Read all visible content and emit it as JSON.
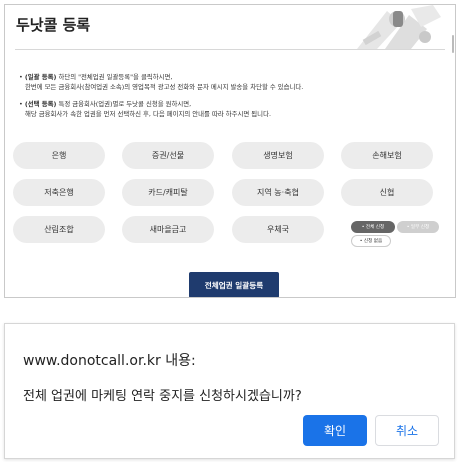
{
  "page": {
    "title": "두낫콜 등록",
    "notices": [
      {
        "lead": "(일괄 등록)",
        "line1": " 하단의 \"전체업권 일괄등록\"을 클릭하시면,",
        "line2": "한번에 모든 금융회사(참여업권 소속)의 영업목적 광고성 전화와 문자 메시지 발송을 차단할 수 있습니다."
      },
      {
        "lead": "(선택 등록)",
        "line1": " 특정 금융회사(업권)별로 두낫콜 신청을 원하시면,",
        "line2": "해당 금융회사가 속한 업권을 먼저 선택하신 후, 다음 페이지의 안내를 따라 하주시면 됩니다."
      }
    ],
    "sectors": [
      "은행",
      "증권/선물",
      "생명보험",
      "손해보험",
      "저축은행",
      "카드/캐피탈",
      "지역 농·축협",
      "신협",
      "산림조합",
      "새마을금고",
      "우체국"
    ],
    "legend": {
      "all_selected": "• 전체 신청",
      "partial_selected": "• 일부 신청",
      "unselected": "• 신청 없음"
    },
    "bulk_button": "전체업권 일괄등록"
  },
  "dialog": {
    "origin": "www.donotcall.or.kr 내용:",
    "message": "전체 업권에 마케팅 연락 중지를 신청하시겠습니까?",
    "ok_label": "확인",
    "cancel_label": "취소"
  },
  "colors": {
    "primary_button": "#1f3b6e",
    "dialog_ok": "#1a73e8",
    "pill_bg": "#ececec"
  }
}
